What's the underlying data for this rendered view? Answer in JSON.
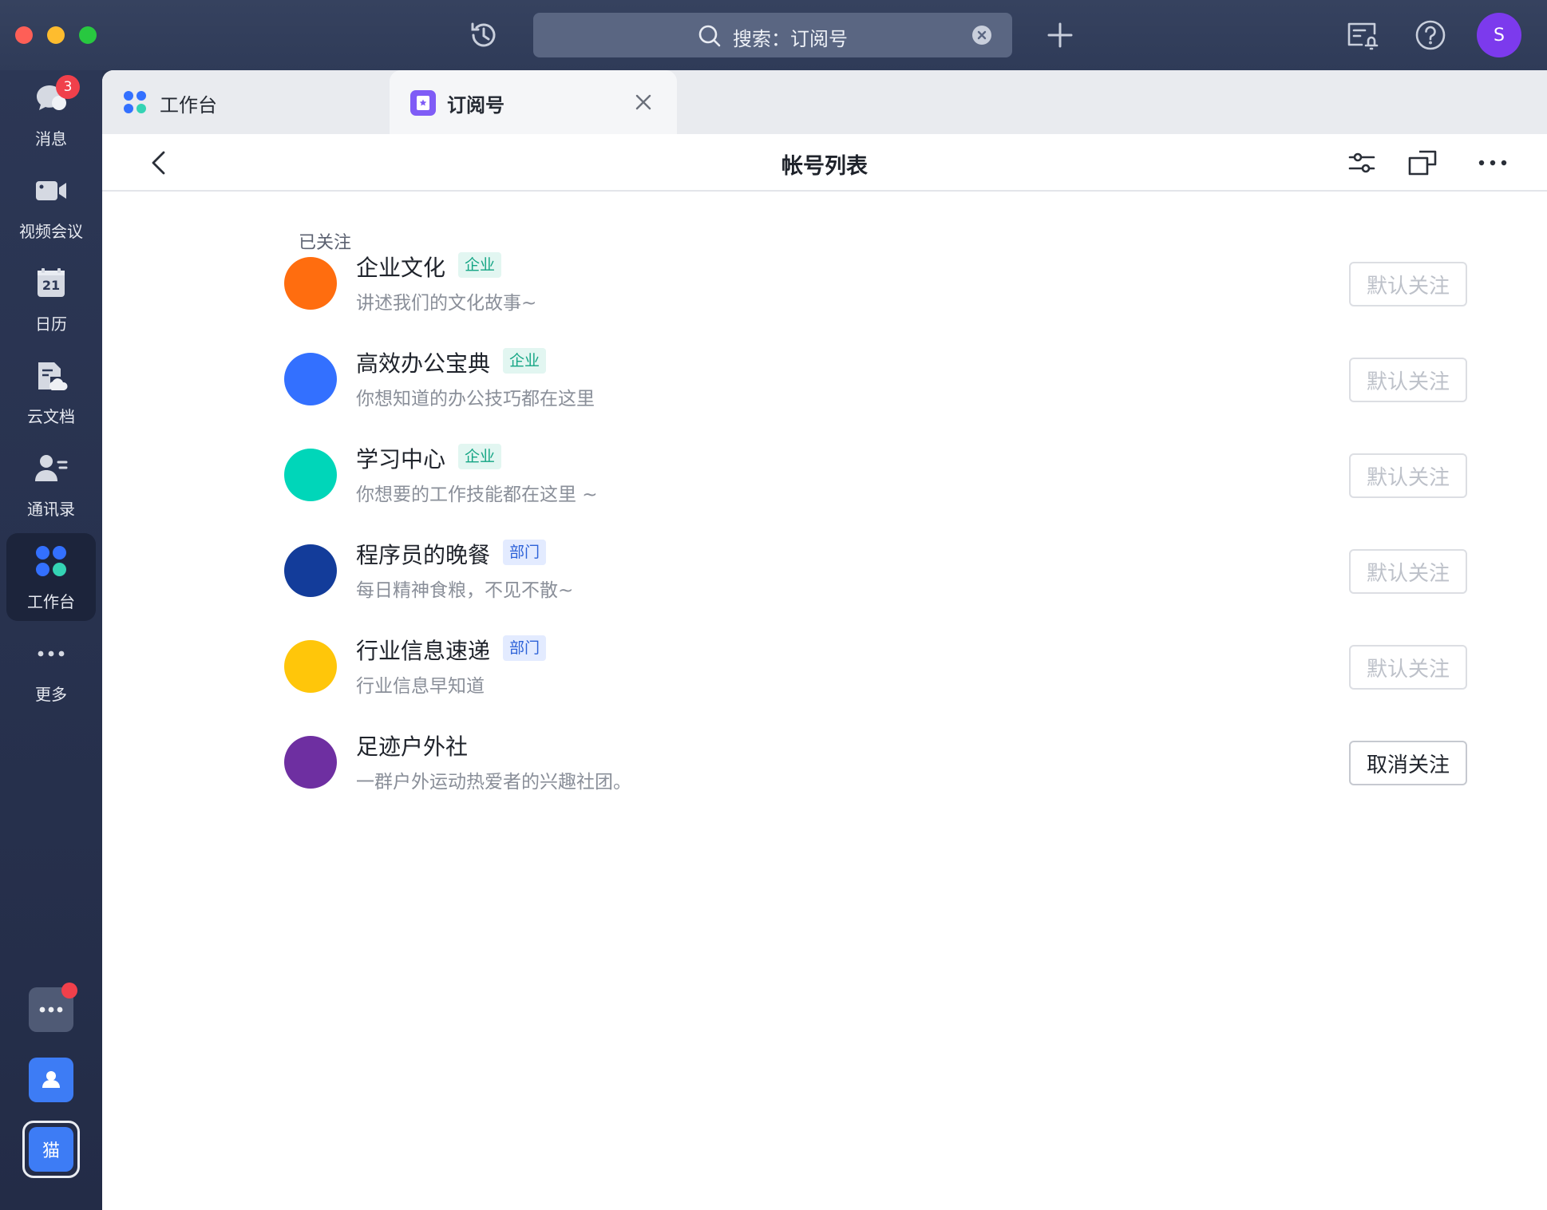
{
  "titlebar": {
    "search_text": "搜索：订阅号",
    "avatar_initial": "S"
  },
  "sidebar": {
    "items": [
      {
        "label": "消息",
        "badge": "3"
      },
      {
        "label": "视频会议"
      },
      {
        "label": "日历",
        "icon_text": "21"
      },
      {
        "label": "云文档"
      },
      {
        "label": "通讯录"
      },
      {
        "label": "工作台"
      },
      {
        "label": "更多"
      }
    ],
    "bottom_app_label": "猫"
  },
  "tabs": [
    {
      "label": "工作台"
    },
    {
      "label": "订阅号"
    }
  ],
  "page": {
    "title": "帐号列表",
    "section_title": "已关注"
  },
  "accounts": [
    {
      "name": "企业文化",
      "tag": "企业",
      "tag_type": "enterprise",
      "desc": "讲述我们的文化故事~",
      "button": "默认关注",
      "button_enabled": false,
      "color": "#ff6d0f"
    },
    {
      "name": "高效办公宝典",
      "tag": "企业",
      "tag_type": "enterprise",
      "desc": "你想知道的办公技巧都在这里",
      "button": "默认关注",
      "button_enabled": false,
      "color": "#3370ff"
    },
    {
      "name": "学习中心",
      "tag": "企业",
      "tag_type": "enterprise",
      "desc": "你想要的工作技能都在这里 ~",
      "button": "默认关注",
      "button_enabled": false,
      "color": "#00d6b9"
    },
    {
      "name": "程序员的晚餐",
      "tag": "部门",
      "tag_type": "department",
      "desc": "每日精神食粮，不见不散~",
      "button": "默认关注",
      "button_enabled": false,
      "color": "#133c9a"
    },
    {
      "name": "行业信息速递",
      "tag": "部门",
      "tag_type": "department",
      "desc": "行业信息早知道",
      "button": "默认关注",
      "button_enabled": false,
      "color": "#ffc60a"
    },
    {
      "name": "足迹户外社",
      "tag": "",
      "tag_type": "",
      "desc": "一群户外运动热爱者的兴趣社团。",
      "button": "取消关注",
      "button_enabled": true,
      "color": "#6e2fa1"
    }
  ],
  "colors": {
    "accent": "#3370ff",
    "badge": "#f0404b",
    "avatar_top": "#7c3aed"
  },
  "icons": [
    "history-icon",
    "search-icon",
    "clear-icon",
    "plus-icon",
    "announcement-icon",
    "help-icon",
    "back-icon",
    "filter-icon",
    "new-window-icon",
    "more-icon",
    "close-icon"
  ]
}
